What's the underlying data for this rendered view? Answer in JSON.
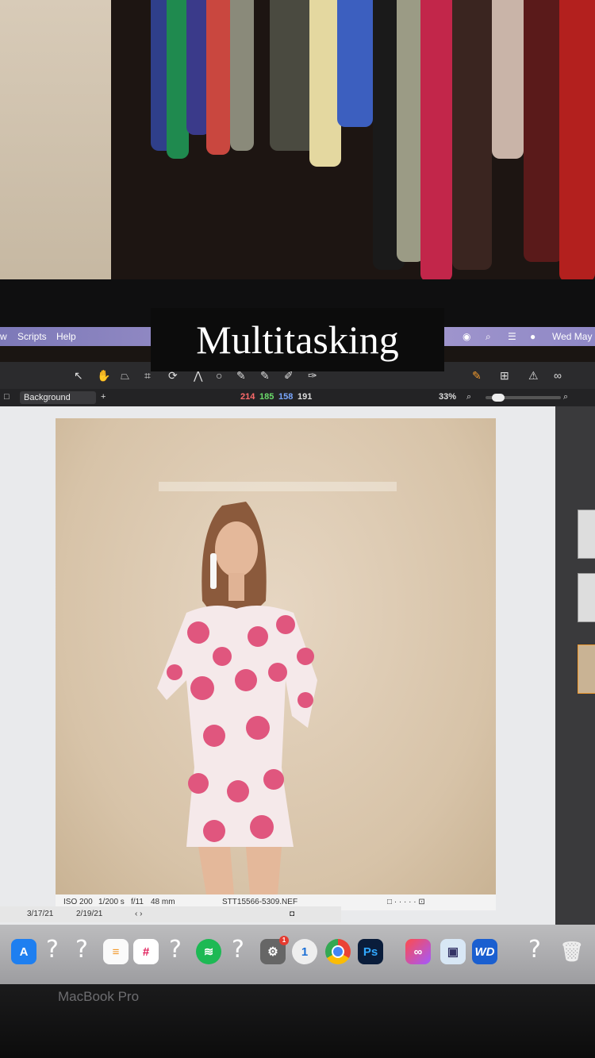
{
  "overlay": {
    "caption": "Multitasking"
  },
  "menubar": {
    "items": [
      "w",
      "Scripts",
      "Help"
    ],
    "clock": "Wed May"
  },
  "toolbar": {
    "tools": [
      "pointer-tool",
      "hand-tool",
      "keystone-tool",
      "crop-tool",
      "rotate-tool",
      "straighten-tool",
      "spot-tool",
      "brush-tool",
      "erase-tool",
      "gradient-tool",
      "picker-tool"
    ]
  },
  "infobar": {
    "layer": "Background",
    "rgb": {
      "r": "214",
      "g": "185",
      "b": "158",
      "a": "191"
    },
    "zoom": "33%"
  },
  "image_meta": {
    "iso": "ISO 200",
    "shutter": "1/200 s",
    "aperture": "f/11",
    "focal": "48 mm",
    "filename": "STT15566-5309.NEF"
  },
  "strip": {
    "date1": "3/17/21",
    "date2": "2/19/21"
  },
  "dock": {
    "icons": [
      "app-store-icon",
      "unknown-app-icon",
      "unknown-app-icon",
      "reminders-icon",
      "slack-icon",
      "unknown-app-icon",
      "spotify-icon",
      "unknown-app-icon",
      "system-prefs-icon",
      "onepassword-icon",
      "chrome-icon",
      "photoshop-icon",
      "creative-cloud-icon",
      "preview-icon",
      "wd-icon",
      "unknown-app-icon",
      "trash-icon"
    ],
    "badge": "1",
    "ps_label": "Ps",
    "wd_label": "WD",
    "unknown": "?"
  },
  "bezel": {
    "brand": "MacBook Pro"
  },
  "colors": {
    "accent": "#f29a2e",
    "menubar": "#8f88c6",
    "dress": "#e0567e"
  }
}
